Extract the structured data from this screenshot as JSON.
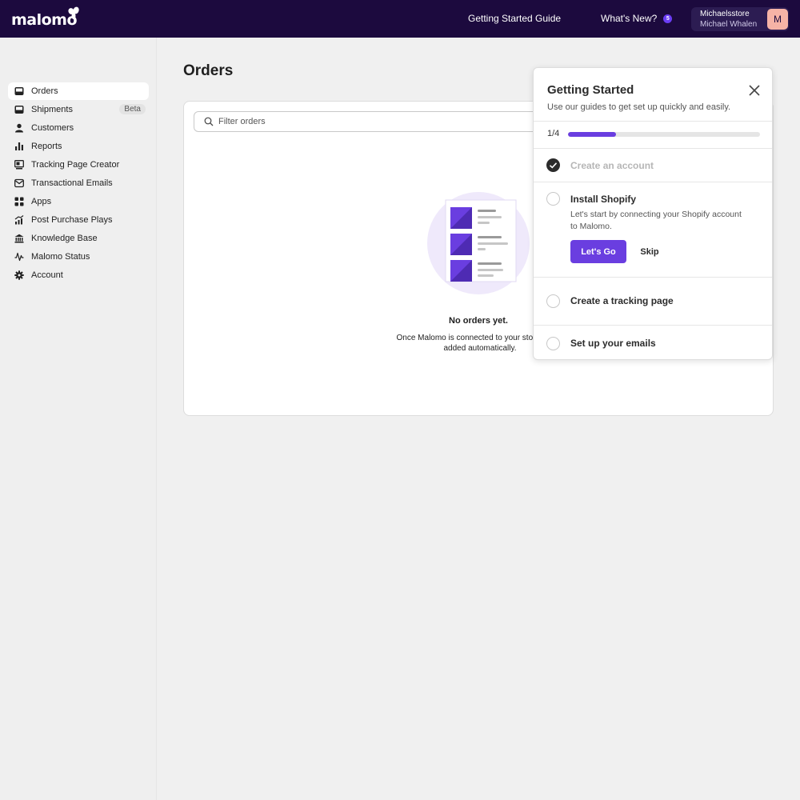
{
  "header": {
    "logo_text": "malomo",
    "nav": {
      "getting_started_guide": "Getting Started Guide",
      "whats_new": "What's New?",
      "whats_new_count": "5"
    },
    "account": {
      "store": "Michaelsstore",
      "user": "Michael Whalen",
      "avatar_initial": "M"
    }
  },
  "sidebar": {
    "items": [
      {
        "label": "Orders",
        "icon": "inbox-icon",
        "active": true
      },
      {
        "label": "Shipments",
        "icon": "box-icon",
        "badge": "Beta"
      },
      {
        "label": "Customers",
        "icon": "person-icon"
      },
      {
        "label": "Reports",
        "icon": "bar-chart-icon"
      },
      {
        "label": "Tracking Page Creator",
        "icon": "page-layout-icon"
      },
      {
        "label": "Transactional Emails",
        "icon": "mail-icon"
      },
      {
        "label": "Apps",
        "icon": "apps-grid-icon"
      },
      {
        "label": "Post Purchase Plays",
        "icon": "growth-chart-icon"
      },
      {
        "label": "Knowledge Base",
        "icon": "bank-icon"
      },
      {
        "label": "Malomo Status",
        "icon": "pulse-icon"
      },
      {
        "label": "Account",
        "icon": "gear-icon"
      }
    ]
  },
  "main": {
    "title": "Orders",
    "filter_placeholder": "Filter orders",
    "empty_title": "No orders yet.",
    "empty_desc": "Once Malomo is connected to your store accou\nadded automatically."
  },
  "getting_started": {
    "title": "Getting Started",
    "subtitle": "Use our guides to get set up quickly and easily.",
    "progress_label": "1/4",
    "progress_fraction": 0.25,
    "steps": [
      {
        "label": "Create an account",
        "done": true
      },
      {
        "label": "Install Shopify",
        "done": false,
        "description": "Let's start by connecting your Shopify account to Malomo.",
        "primary_action": "Let's Go",
        "secondary_action": "Skip"
      },
      {
        "label": "Create a tracking page",
        "done": false
      },
      {
        "label": "Set up your emails",
        "done": false
      }
    ]
  },
  "colors": {
    "topbar": "#1c0a3e",
    "accent": "#6a3ee0",
    "avatar": "#f6b3a6"
  }
}
